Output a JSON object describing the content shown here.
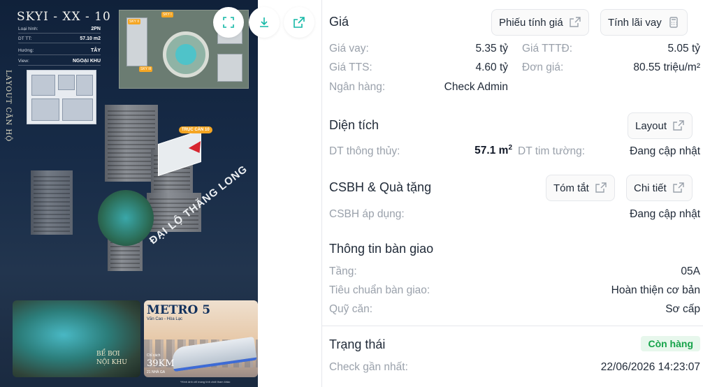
{
  "image": {
    "title": "SKYI - XX - 10",
    "specs": [
      {
        "label": "Loại hình:",
        "value": "2PN"
      },
      {
        "label": "DT TT:",
        "value": "57.10 m2"
      },
      {
        "label": "Hướng:",
        "value": "TÂY"
      },
      {
        "label": "View:",
        "value": "NGOẠI KHU"
      }
    ],
    "layout_vertical": "LAYOUT CĂN HỘ",
    "callout": "TRỤC CĂN 10",
    "road": "ĐẠI LỘ THĂNG LONG",
    "pool_text_1": "BỂ BƠI",
    "pool_text_2": "NỘI KHU",
    "metro_title": "METRO 5",
    "metro_sub": "Văn Cao - Hòa Lạc",
    "metro_dist_label": "Chỉ cách",
    "metro_dist": "39KM",
    "metro_stations": "21 NHÀ GA",
    "note": "*Hình ảnh chỉ mang tính chất tham khảo",
    "buttons": {
      "fullscreen_icon": "fullscreen-icon",
      "download_icon": "download-icon",
      "open_icon": "external-link-icon"
    }
  },
  "price": {
    "title": "Giá",
    "btn_quote": "Phiếu tính giá",
    "btn_loan": "Tính lãi vay",
    "rows": [
      {
        "label": "Giá vay:",
        "value": "5.35 tỷ"
      },
      {
        "label": "Giá TTTĐ:",
        "value": "5.05 tỷ"
      },
      {
        "label": "Giá TTS:",
        "value": "4.60 tỷ"
      },
      {
        "label": "Đơn giá:",
        "value": "80.55 triệu/m²"
      },
      {
        "label": "Ngân hàng:",
        "value": "Check Admin"
      }
    ]
  },
  "area": {
    "title": "Diện tích",
    "btn_layout": "Layout",
    "label_carpet": "DT thông thủy:",
    "value_carpet": "57.1 m",
    "value_carpet_sup": "2",
    "label_wall": "DT tim tường:",
    "value_wall": "Đang cập nhật"
  },
  "policy": {
    "title": "CSBH & Quà tặng",
    "btn_summary": "Tóm tắt",
    "btn_detail": "Chi tiết",
    "label": "CSBH áp dụng:",
    "value": "Đang cập nhật"
  },
  "handover": {
    "title": "Thông tin bàn giao",
    "rows": [
      {
        "label": "Tầng:",
        "value": "05A"
      },
      {
        "label": "Tiêu chuẩn bàn giao:",
        "value": "Hoàn thiện cơ bản"
      },
      {
        "label": "Quỹ căn:",
        "value": "Sơ cấp"
      }
    ]
  },
  "status": {
    "title": "Trạng thái",
    "badge": "Còn hàng",
    "badge_color": "#16a34a",
    "label_check": "Check gần nhất:",
    "value_check": "22/06/2026 14:23:07"
  }
}
